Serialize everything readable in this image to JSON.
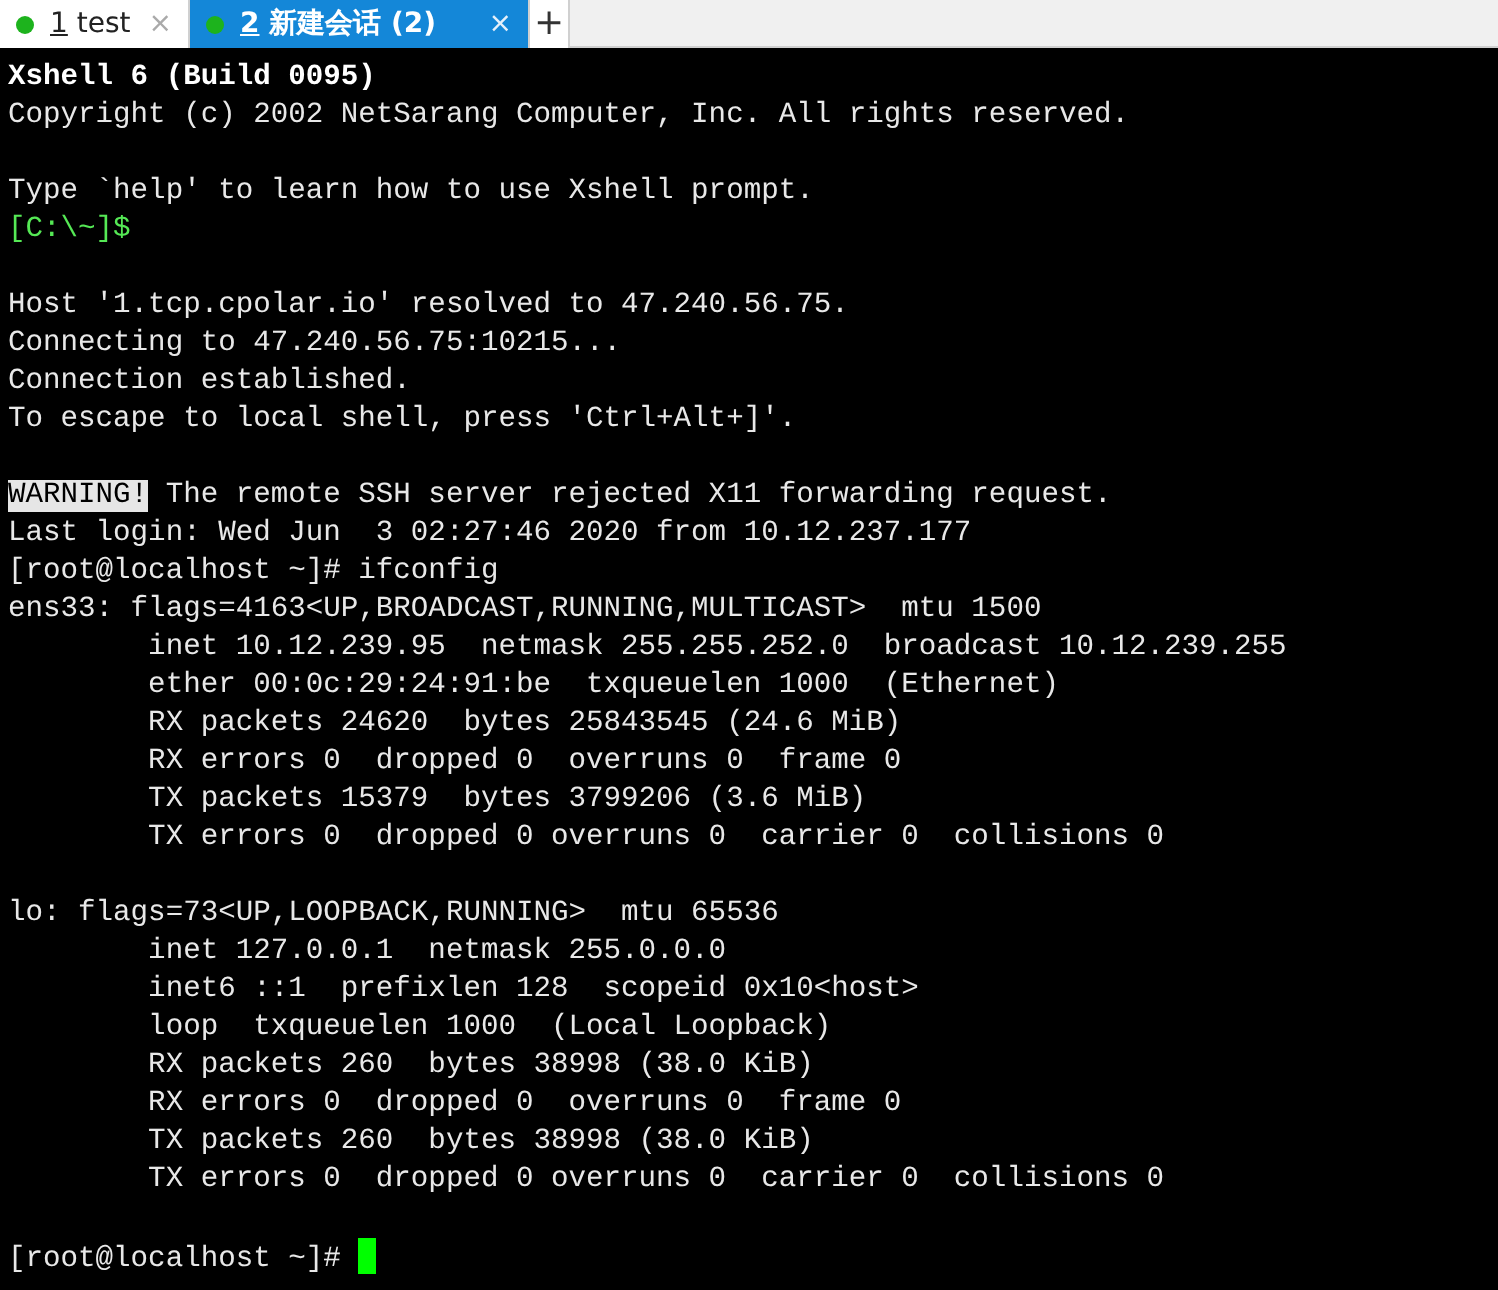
{
  "tabs": [
    {
      "number": "1",
      "label": "test",
      "color": "#1db31d",
      "selected": false,
      "close": "×"
    },
    {
      "number": "2",
      "label": "新建会话 (2)",
      "color": "#1db31d",
      "selected": true,
      "close": "×"
    }
  ],
  "new_tab": "+",
  "terminal": {
    "lines": [
      {
        "kind": "bold",
        "text": "Xshell 6 (Build 0095)"
      },
      {
        "kind": "normal",
        "text": "Copyright (c) 2002 NetSarang Computer, Inc. All rights reserved."
      },
      {
        "kind": "blank"
      },
      {
        "kind": "normal",
        "text": "Type `help' to learn how to use Xshell prompt."
      },
      {
        "kind": "prompt",
        "text": "[C:\\~]$"
      },
      {
        "kind": "blank"
      },
      {
        "kind": "normal",
        "text": "Host '1.tcp.cpolar.io' resolved to 47.240.56.75."
      },
      {
        "kind": "normal",
        "text": "Connecting to 47.240.56.75:10215..."
      },
      {
        "kind": "normal",
        "text": "Connection established."
      },
      {
        "kind": "normal",
        "text": "To escape to local shell, press 'Ctrl+Alt+]'."
      },
      {
        "kind": "blank"
      },
      {
        "kind": "mixed",
        "segments": [
          {
            "kind": "highlight",
            "text": "WARNING!"
          },
          {
            "kind": "normal",
            "text": " The remote SSH server rejected X11 forwarding request."
          }
        ]
      },
      {
        "kind": "normal",
        "text": "Last login: Wed Jun  3 02:27:46 2020 from 10.12.237.177"
      },
      {
        "kind": "normal",
        "text": "[root@localhost ~]# ifconfig"
      },
      {
        "kind": "normal",
        "text": "ens33: flags=4163<UP,BROADCAST,RUNNING,MULTICAST>  mtu 1500"
      },
      {
        "kind": "normal",
        "text": "        inet 10.12.239.95  netmask 255.255.252.0  broadcast 10.12.239.255"
      },
      {
        "kind": "normal",
        "text": "        ether 00:0c:29:24:91:be  txqueuelen 1000  (Ethernet)"
      },
      {
        "kind": "normal",
        "text": "        RX packets 24620  bytes 25843545 (24.6 MiB)"
      },
      {
        "kind": "normal",
        "text": "        RX errors 0  dropped 0  overruns 0  frame 0"
      },
      {
        "kind": "normal",
        "text": "        TX packets 15379  bytes 3799206 (3.6 MiB)"
      },
      {
        "kind": "normal",
        "text": "        TX errors 0  dropped 0 overruns 0  carrier 0  collisions 0"
      },
      {
        "kind": "blank"
      },
      {
        "kind": "normal",
        "text": "lo: flags=73<UP,LOOPBACK,RUNNING>  mtu 65536"
      },
      {
        "kind": "normal",
        "text": "        inet 127.0.0.1  netmask 255.0.0.0"
      },
      {
        "kind": "normal",
        "text": "        inet6 ::1  prefixlen 128  scopeid 0x10<host>"
      },
      {
        "kind": "normal",
        "text": "        loop  txqueuelen 1000  (Local Loopback)"
      },
      {
        "kind": "normal",
        "text": "        RX packets 260  bytes 38998 (38.0 KiB)"
      },
      {
        "kind": "normal",
        "text": "        RX errors 0  dropped 0  overruns 0  frame 0"
      },
      {
        "kind": "normal",
        "text": "        TX packets 260  bytes 38998 (38.0 KiB)"
      },
      {
        "kind": "normal",
        "text": "        TX errors 0  dropped 0 overruns 0  carrier 0  collisions 0"
      },
      {
        "kind": "blank"
      },
      {
        "kind": "normal",
        "text": "[root@localhost ~]#",
        "cursor": true
      }
    ]
  }
}
